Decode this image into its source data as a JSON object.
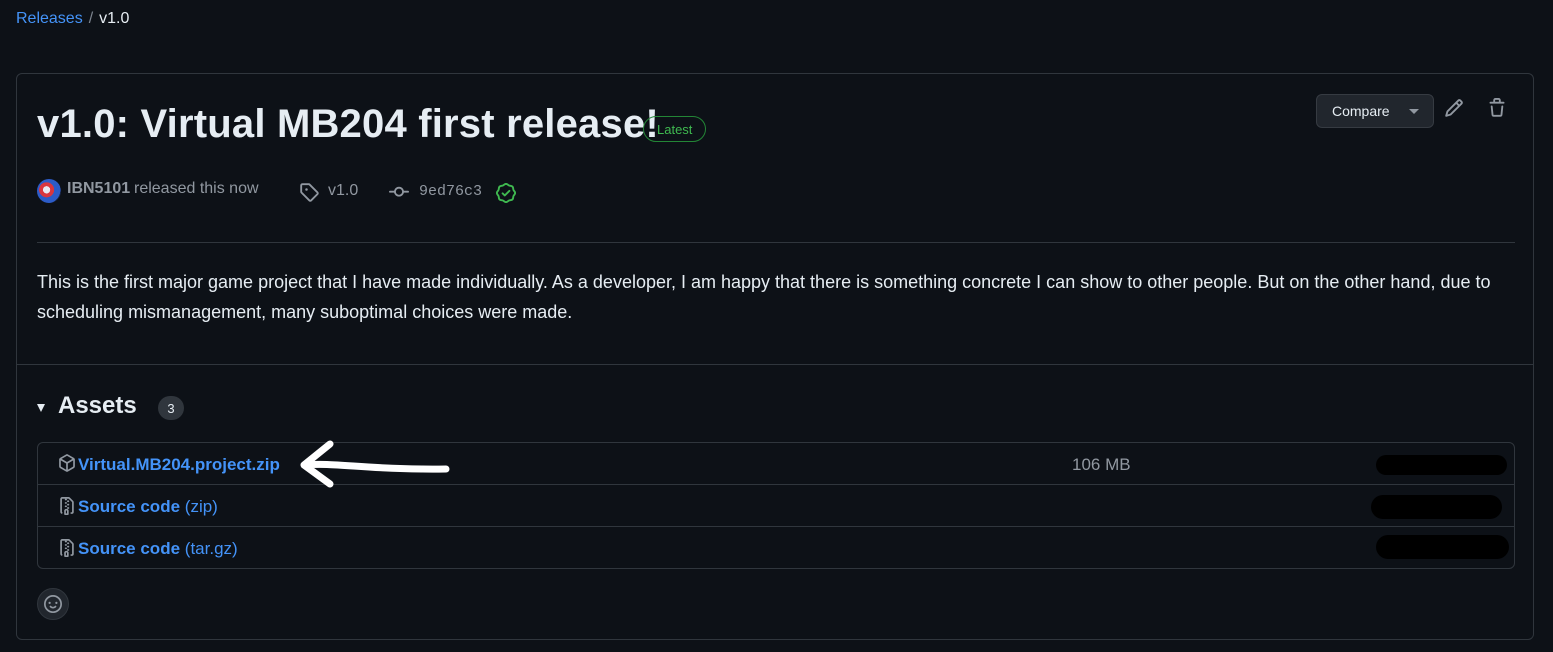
{
  "breadcrumb": {
    "releases": "Releases",
    "separator": "/",
    "current": "v1.0"
  },
  "release": {
    "title": "v1.0: Virtual MB204 first release!",
    "latest_badge": "Latest",
    "compare_label": "Compare",
    "author": "IBN5101",
    "released_text": "released this now",
    "tag": "v1.0",
    "commit": "9ed76c3",
    "description": "This is the first major game project that I have made individually. As a developer, I am happy that there is something concrete I can show to other people. But on the other hand, due to scheduling mismanagement, many suboptimal choices were made."
  },
  "assets": {
    "title": "Assets",
    "count": "3",
    "items": [
      {
        "name": "Virtual.MB204.project.zip",
        "suffix": "",
        "size": "106 MB",
        "icon": "package-icon"
      },
      {
        "name": "Source code",
        "suffix": "(zip)",
        "size": "",
        "icon": "file-zip-icon"
      },
      {
        "name": "Source code",
        "suffix": "(tar.gz)",
        "size": "",
        "icon": "file-zip-icon"
      }
    ]
  },
  "colors": {
    "background": "#0d1117",
    "link": "#4493f8",
    "latest": "#3fb950",
    "muted": "#9198a1",
    "border": "#30363d"
  }
}
